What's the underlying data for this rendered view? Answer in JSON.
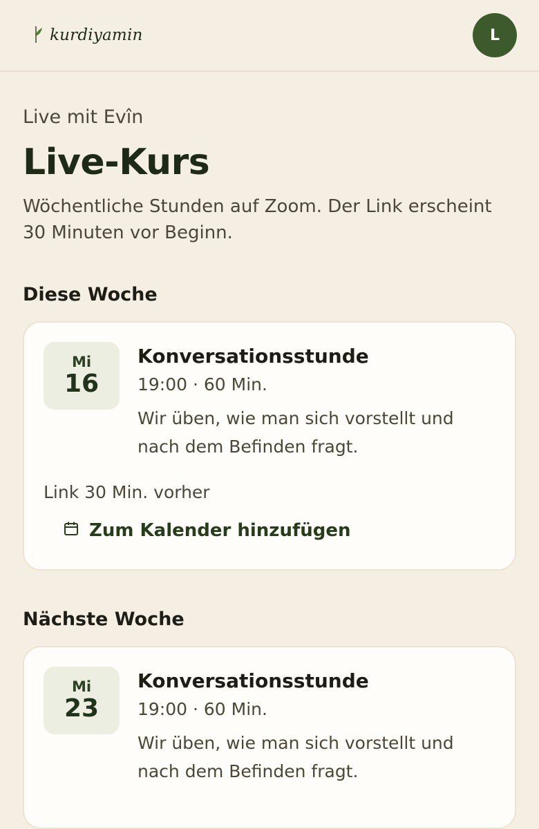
{
  "brand": {
    "name": "kurdiyamin",
    "logo_icon": "leaf-icon"
  },
  "user": {
    "avatar_initial": "L"
  },
  "header": {
    "eyebrow": "Live mit Evîn",
    "title": "Live-Kurs",
    "subtitle": "Wöchentliche Stunden auf Zoom. Der Link erscheint 30 Minuten vor Beginn."
  },
  "sections": [
    {
      "title": "Diese Woche",
      "event": {
        "day": "Mi",
        "date": "16",
        "title": "Konversationsstunde",
        "meta": "19:00 · 60 Min.",
        "description": "Wir üben, wie man sich vorstellt und nach dem Befinden fragt.",
        "link_note": "Link 30 Min. vorher",
        "calendar_label": "Zum Kalender hinzufügen"
      }
    },
    {
      "title": "Nächste Woche",
      "event": {
        "day": "Mi",
        "date": "23",
        "title": "Konversationsstunde",
        "meta": "19:00 · 60 Min.",
        "description": "Wir üben, wie man sich vorstellt und nach dem Befinden fragt."
      }
    }
  ],
  "colors": {
    "accent": "#3d5a2c",
    "background": "#f5efe3",
    "card": "#fffdf9",
    "date_bg": "#ebeee1"
  }
}
